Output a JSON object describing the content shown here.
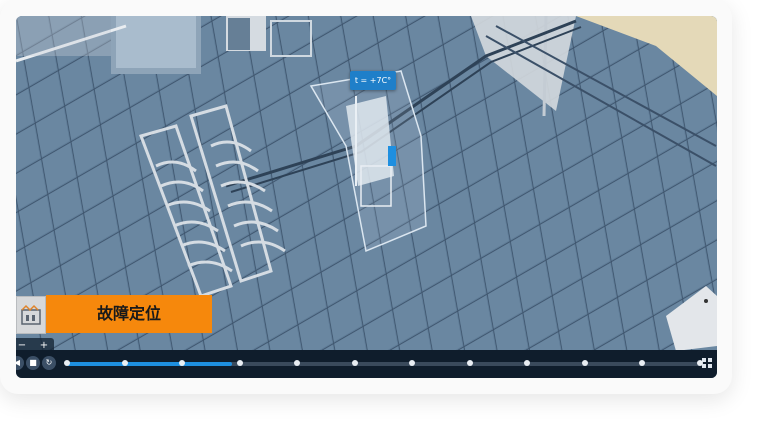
{
  "viewport": {
    "temperature_tag": "t = +7C°"
  },
  "fault_panel": {
    "icon": "factory-icon",
    "label": "故障定位"
  },
  "zoom": {
    "minus": "−",
    "plus": "+"
  },
  "timeline": {
    "controls": [
      {
        "name": "prev-icon",
        "glyph": "◀"
      },
      {
        "name": "camera-icon",
        "glyph": "■"
      },
      {
        "name": "refresh-icon",
        "glyph": "↻"
      }
    ],
    "progress_fraction": 0.26,
    "marker_count": 12,
    "accent_color": "#1e8fe0",
    "grid_icon": "grid-icon"
  }
}
